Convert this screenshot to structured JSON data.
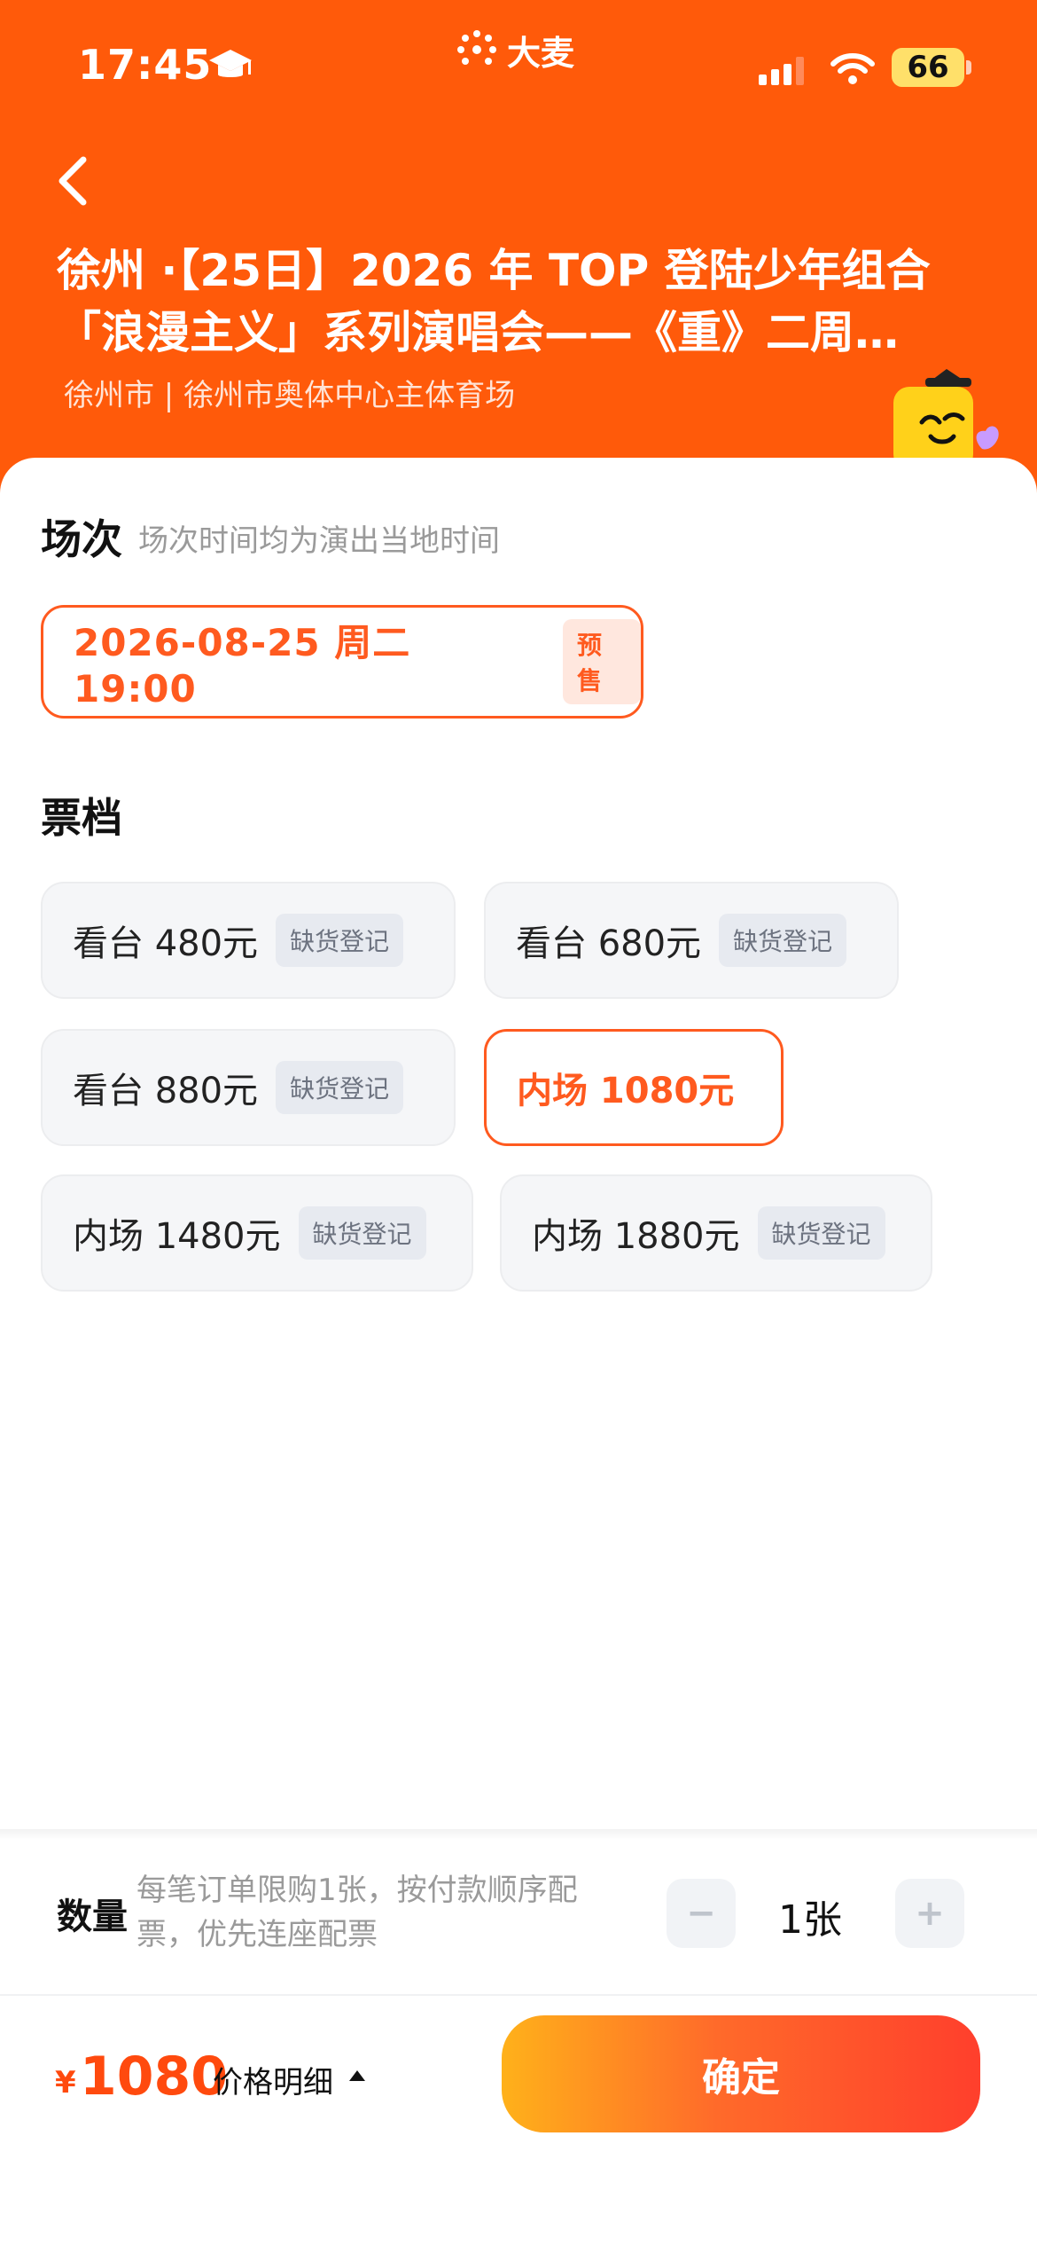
{
  "status": {
    "time": "17:45",
    "battery": "66"
  },
  "brand": {
    "name": "大麦"
  },
  "header": {
    "title": "徐州 ·【25日】2026 年 TOP 登陆少年组合「浪漫主义」系列演唱会——《重》二周年…",
    "venue": "徐州市 | 徐州市奥体中心主体育场"
  },
  "session": {
    "title": "场次",
    "subtitle": "场次时间均为演出当地时间",
    "selected": {
      "text": "2026-08-25  周二 19:00",
      "tag": "预售"
    }
  },
  "tiers": {
    "title": "票档",
    "items": [
      {
        "label": "看台 480元",
        "badge": "缺货登记",
        "selected": false
      },
      {
        "label": "看台 680元",
        "badge": "缺货登记",
        "selected": false
      },
      {
        "label": "看台 880元",
        "badge": "缺货登记",
        "selected": false
      },
      {
        "label": "内场 1080元",
        "badge": "",
        "selected": true
      },
      {
        "label": "内场 1480元",
        "badge": "缺货登记",
        "selected": false
      },
      {
        "label": "内场 1880元",
        "badge": "缺货登记",
        "selected": false
      }
    ]
  },
  "quantity": {
    "label": "数量",
    "note": "每笔订单限购1张，按付款顺序配票，优先连座配票",
    "minus": "−",
    "value": "1张",
    "plus": "+"
  },
  "footer": {
    "currency": "¥",
    "amount": "1080",
    "detail_label": "价格明细",
    "confirm_label": "确定"
  },
  "colors": {
    "accent": "#FF5A0A",
    "selected_border": "#FF5A1F"
  }
}
